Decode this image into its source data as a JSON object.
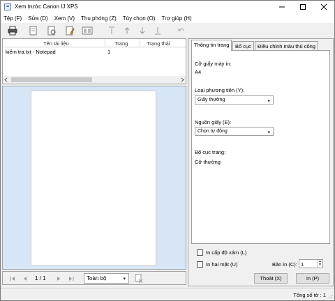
{
  "window": {
    "title": "Xem trước Canon IJ XPS"
  },
  "menu": {
    "items": [
      "Tệp (F)",
      "Sửa (D)",
      "Xem (V)",
      "Thu phóng (Z)",
      "Tùy chọn (O)",
      "Trợ giúp (H)"
    ]
  },
  "doclist": {
    "headers": [
      "Tên tài liệu",
      "Trang",
      "Trạng thái"
    ],
    "rows": [
      {
        "name": "kiểm tra.txt - Notepad",
        "pages": "1",
        "status": ""
      }
    ]
  },
  "nav": {
    "page_indicator": "1 / 1",
    "range_select": "Toàn bộ"
  },
  "tabs": {
    "labels": [
      "Thông tin trang",
      "Bố cục",
      "Điều chỉnh màu thủ công"
    ],
    "active_index": 0
  },
  "page_info": {
    "paper_size_label": "Cỡ giấy máy in:",
    "paper_size_value": "A4",
    "media_type_label": "Loại phương tiện (Y):",
    "media_type_value": "Giấy thường",
    "paper_source_label": "Nguồn giấy (E):",
    "paper_source_value": "Chọn tự động",
    "layout_label": "Bố cục trang:",
    "layout_value": "Cỡ thường"
  },
  "options": {
    "grayscale_label": "In cấp độ xám (L)",
    "grayscale_checked": false,
    "duplex_label": "In hai mặt (U)",
    "duplex_checked": false,
    "copies_label": "Bản in (C):",
    "copies_value": "1"
  },
  "buttons": {
    "exit": "Thoát (X)",
    "print": "In (P)"
  },
  "status": {
    "total_sheets": "Tổng số tờ :  1"
  },
  "colors": {
    "preview_bg": "#d7e6f6",
    "window_bg": "#f0f0f0"
  }
}
